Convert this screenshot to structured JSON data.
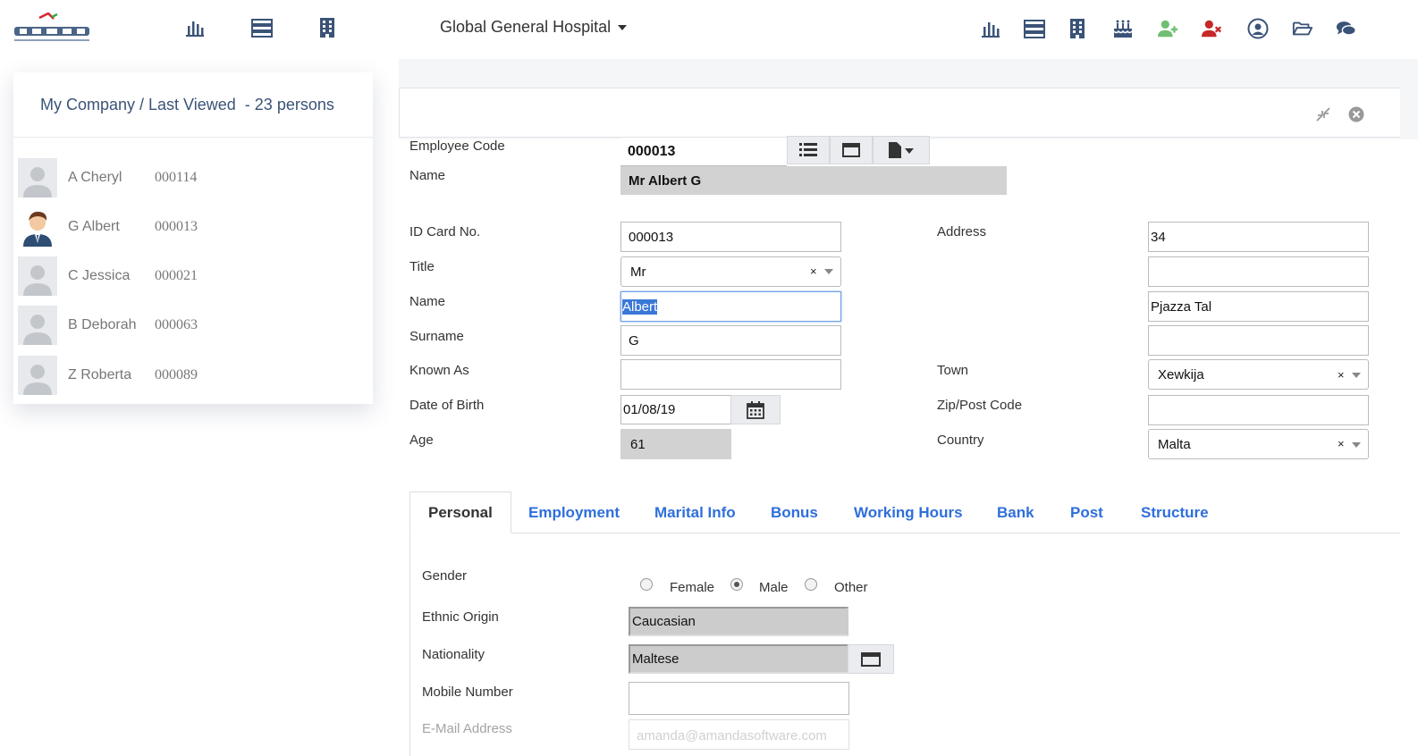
{
  "topbar": {
    "company": "Global General Hospital",
    "left_icons": [
      "bar-chart-icon",
      "server-icon",
      "building-icon"
    ],
    "right_icons": [
      "bar-chart-icon",
      "server-icon",
      "building-icon",
      "birthday-cake-icon",
      "user-plus-icon",
      "user-remove-icon",
      "user-circle-icon",
      "folder-open-icon",
      "comments-icon"
    ]
  },
  "dropdown": {
    "title": "My Company / Last Viewed",
    "count": "- 23 persons",
    "persons": [
      {
        "name": "A Cheryl",
        "code": "000114"
      },
      {
        "name": "G Albert",
        "code": "000013"
      },
      {
        "name": "C Jessica",
        "code": "000021"
      },
      {
        "name": "B Deborah",
        "code": "000063"
      },
      {
        "name": "Z Roberta",
        "code": "000089"
      }
    ]
  },
  "form": {
    "employee_code_label": "Employee Code",
    "employee_code": "000013",
    "name_label": "Name",
    "full_name": "Mr Albert G",
    "id_card_label": "ID Card No.",
    "id_card": "000013",
    "title_label": "Title",
    "title": "Mr",
    "first_name_label": "Name",
    "first_name": "Albert",
    "surname_label": "Surname",
    "surname": "G",
    "known_as_label": "Known As",
    "known_as": "",
    "dob_label": "Date of Birth",
    "dob": "01/08/19",
    "age_label": "Age",
    "age": "61",
    "address_label": "Address",
    "address1": "34",
    "address2": "",
    "address3": "Pjazza Tal",
    "address4": "",
    "town_label": "Town",
    "town": "Xewkija",
    "zip_label": "Zip/Post Code",
    "zip": "",
    "country_label": "Country",
    "country": "Malta",
    "clear_symbol": "×"
  },
  "tabs": [
    "Personal",
    "Employment",
    "Marital Info",
    "Bonus",
    "Working Hours",
    "Bank",
    "Post",
    "Structure"
  ],
  "personal": {
    "gender_label": "Gender",
    "gender_options": [
      "Female",
      "Male",
      "Other"
    ],
    "gender_selected": "Male",
    "ethnic_label": "Ethnic Origin",
    "ethnic": "Caucasian",
    "nationality_label": "Nationality",
    "nationality": "Maltese",
    "mobile_label": "Mobile Number",
    "mobile": "",
    "email_label": "E-Mail Address",
    "email": "amanda@amandasoftware.com"
  }
}
